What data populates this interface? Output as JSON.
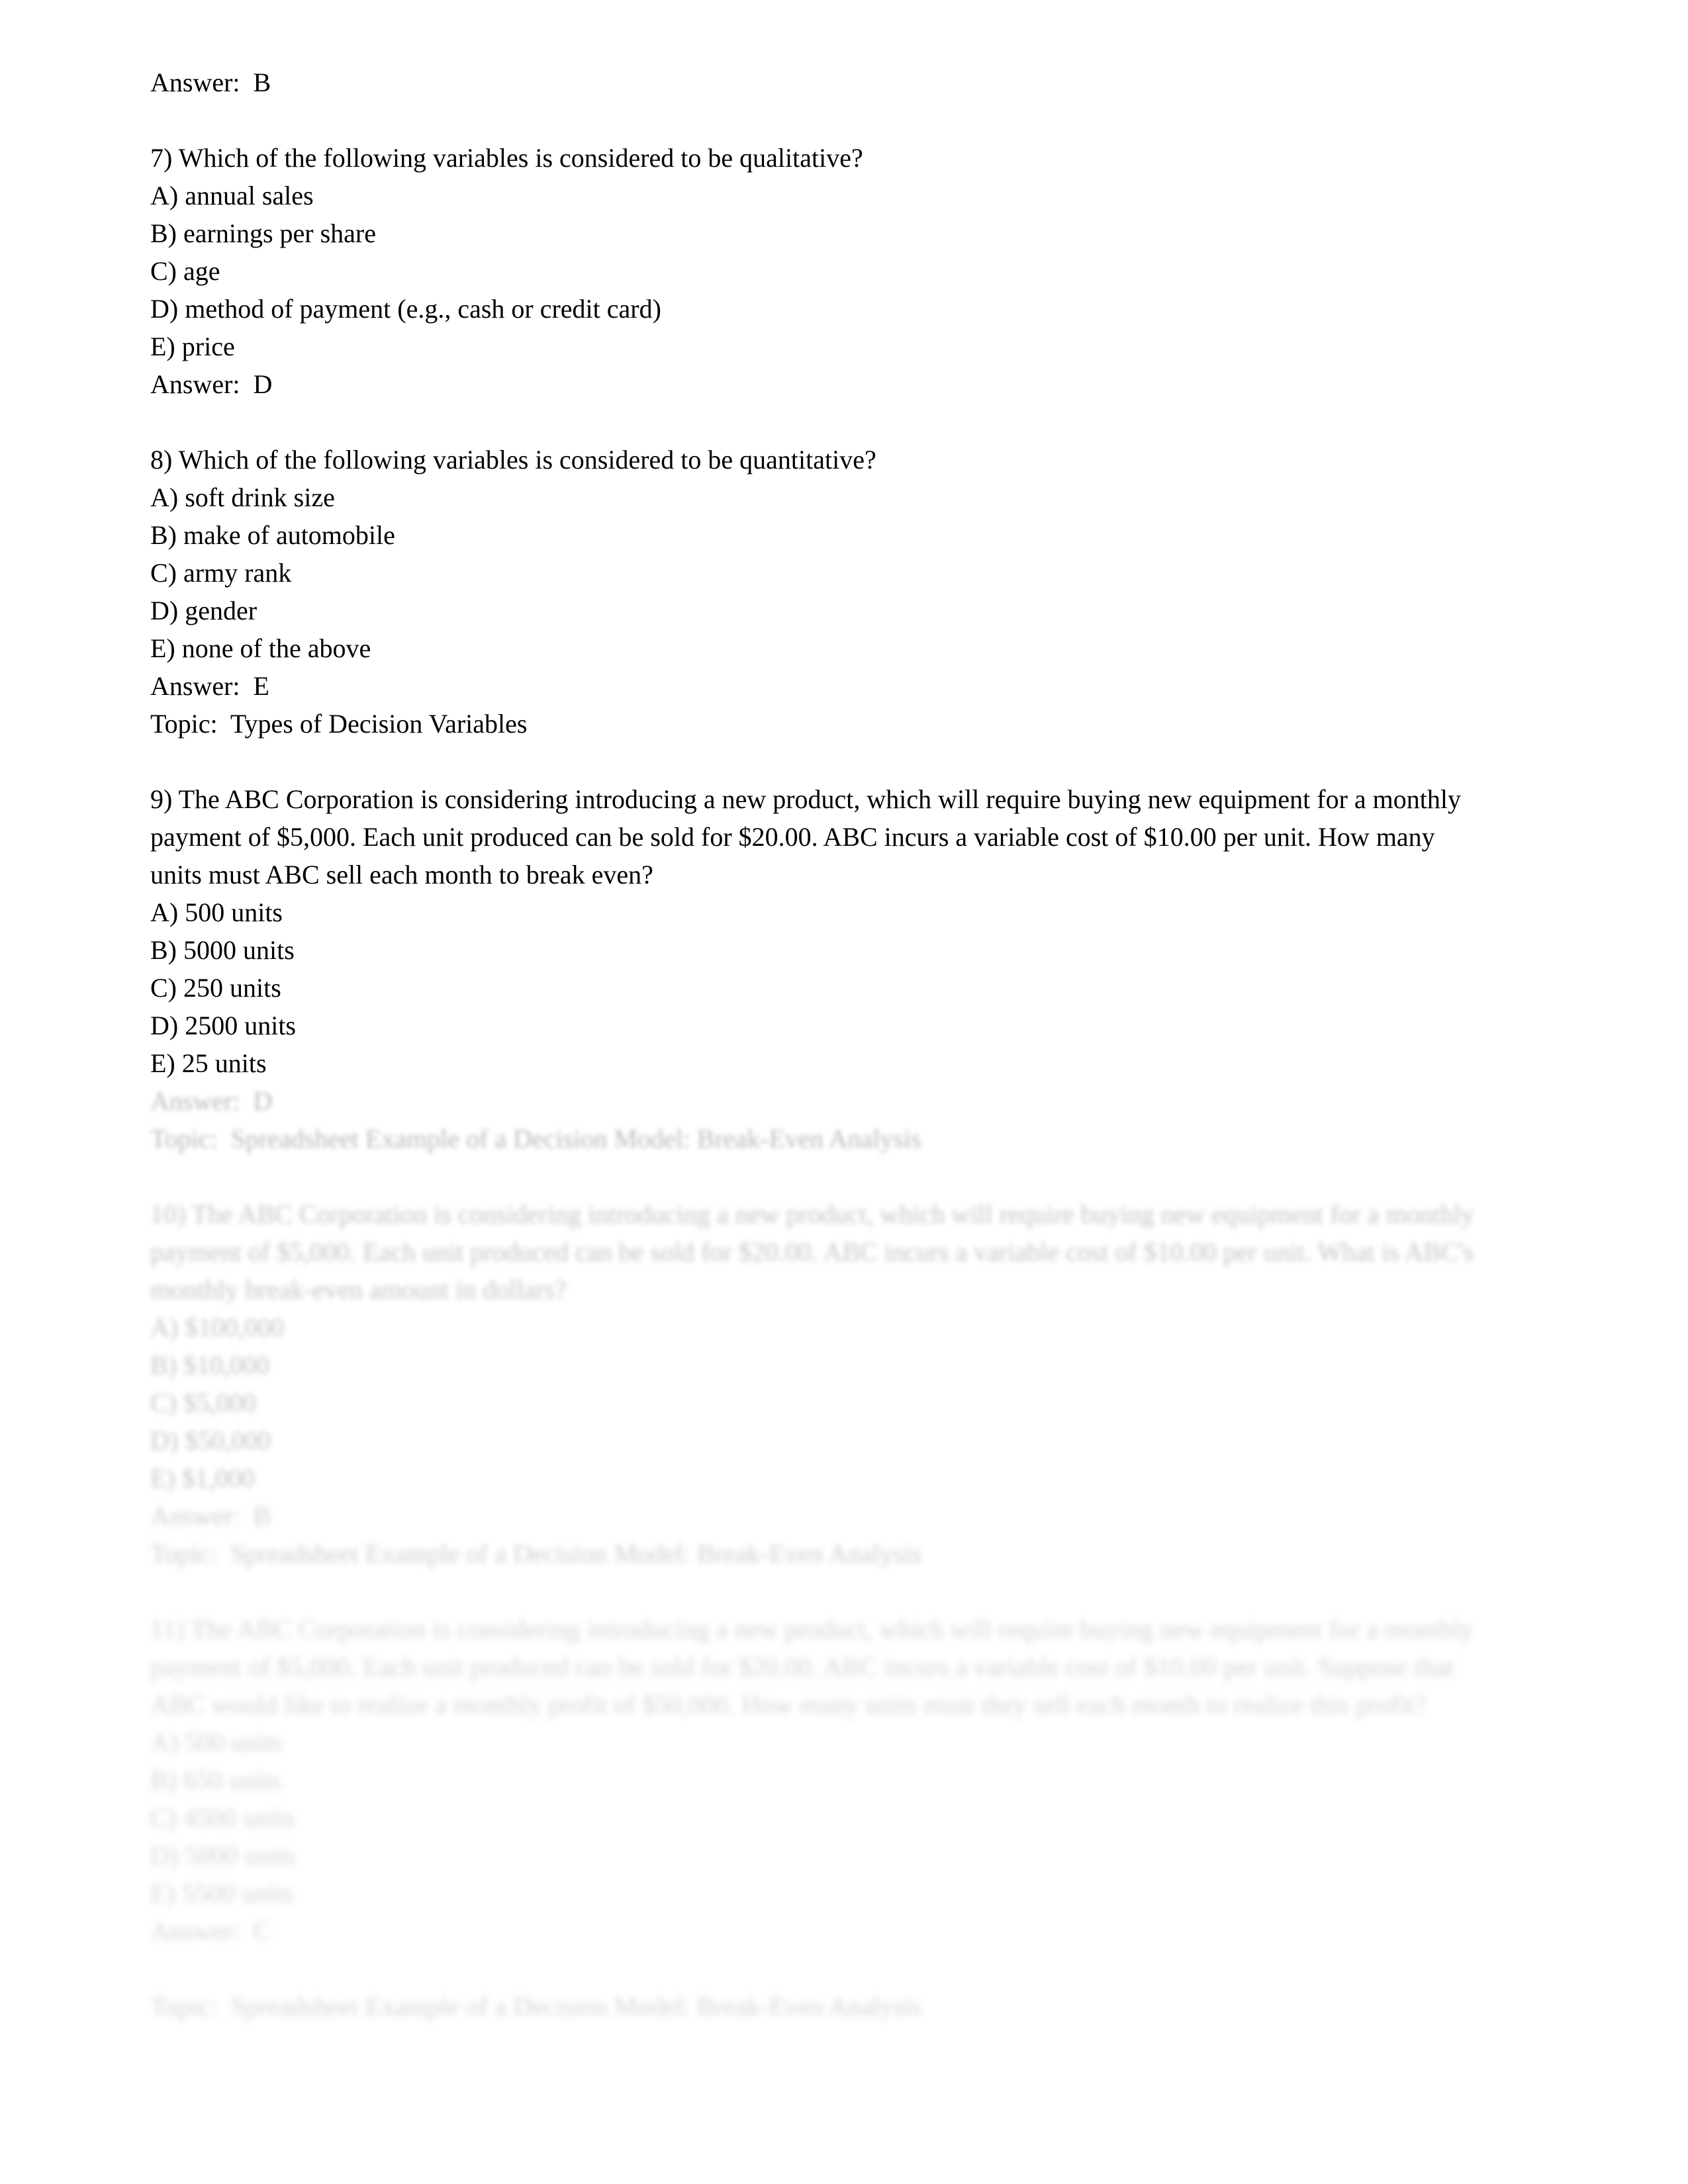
{
  "document": {
    "type": "test-bank-page",
    "font_size_px": 40,
    "line_height_px": 57,
    "blocks": [
      {
        "id": "answer-6",
        "kind": "answer",
        "blurred": false,
        "lines": [
          "Answer:  B"
        ]
      },
      {
        "id": "question-7",
        "kind": "question",
        "blurred": false,
        "stem": "7) Which of the following variables is considered to be qualitative?",
        "options": [
          "A) annual sales",
          "B) earnings per share",
          "C) age",
          "D) method of payment (e.g., cash or credit card)",
          "E) price"
        ],
        "answer": "Answer:  D",
        "topic": null
      },
      {
        "id": "question-8",
        "kind": "question",
        "blurred": false,
        "stem": "8) Which of the following variables is considered to be quantitative?",
        "options": [
          "A) soft drink size",
          "B) make of automobile",
          "C) army rank",
          "D) gender",
          "E) none of the above"
        ],
        "answer": "Answer:  E",
        "topic": "Topic:  Types of Decision Variables"
      },
      {
        "id": "question-9",
        "kind": "question",
        "blurred": false,
        "stem": "9) The ABC Corporation is considering introducing a new product, which will require buying new equipment for a monthly payment of $5,000.  Each unit produced can be sold for $20.00.  ABC incurs a variable cost of $10.00 per unit.  How many units must ABC sell each month to break even?",
        "options": [
          "A) 500 units",
          "B) 5000 units",
          "C) 250 units",
          "D) 2500 units",
          "E) 25 units"
        ],
        "answer": "Answer:  D",
        "answer_blurred": true,
        "topic": "Topic:  Spreadsheet Example of a Decision Model: Break-Even Analysis",
        "topic_blurred": true
      },
      {
        "id": "question-10",
        "kind": "question",
        "blurred": true,
        "blur_tier": 2,
        "stem": "10) The ABC Corporation is considering introducing a new product, which will require buying new equipment for a monthly payment of $5,000.  Each unit produced can be sold for $20.00.  ABC incurs a variable cost of $10.00 per unit.  What is ABC's monthly break-even amount in dollars?",
        "options": [
          "A) $100,000",
          "B) $10,000",
          "C) $5,000",
          "D) $50,000",
          "E) $1,000"
        ],
        "answer": "Answer:  B",
        "topic": "Topic:  Spreadsheet Example of a Decision Model: Break-Even Analysis"
      },
      {
        "id": "question-11",
        "kind": "question",
        "blurred": true,
        "blur_tier": 4,
        "stem": "11) The ABC Corporation is considering introducing a new product, which will require buying new equipment for a monthly payment of $5,000.  Each unit produced can be sold for $20.00.  ABC incurs a variable cost of $10.00 per unit.  Suppose that ABC would like to realize a monthly profit of $50,000.  How many units must they sell each month to realize this profit?",
        "options": [
          "A) 500 units",
          "B) 650 units",
          "C) 4500 units",
          "D) 5000 units",
          "E) 5500 units"
        ],
        "answer": "Answer:  C",
        "topic": "Topic:  Spreadsheet Example of a Decision Model: Break-Even Analysis"
      }
    ]
  }
}
